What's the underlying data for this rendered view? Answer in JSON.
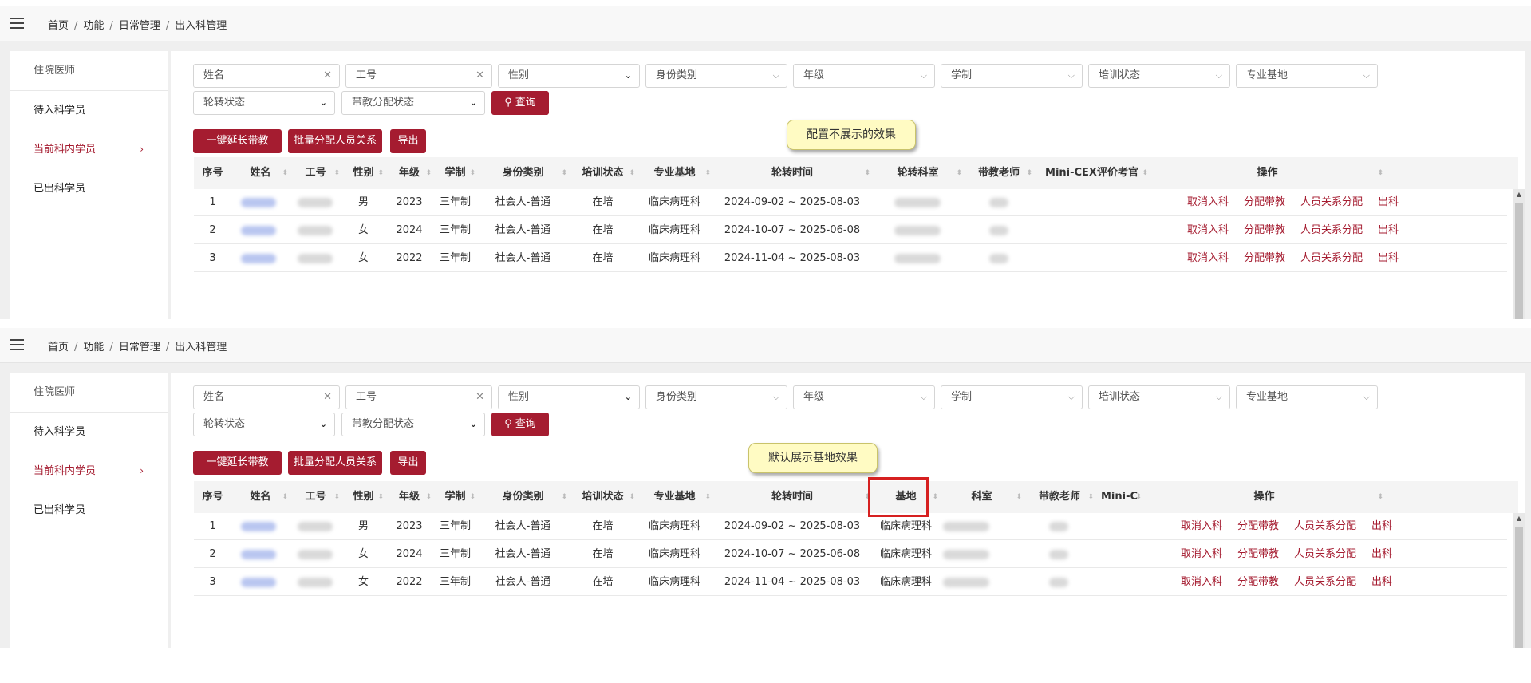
{
  "breadcrumb": [
    "首页",
    "功能",
    "日常管理",
    "出入科管理"
  ],
  "sidebar": {
    "header": "住院医师",
    "items": [
      {
        "label": "待入科学员",
        "active": false
      },
      {
        "label": "当前科内学员",
        "active": true
      },
      {
        "label": "已出科学员",
        "active": false
      }
    ]
  },
  "filters": {
    "name_placeholder": "姓名",
    "id_placeholder": "工号",
    "gender": "性别",
    "identity": "身份类别",
    "grade": "年级",
    "system": "学制",
    "training_status": "培训状态",
    "base": "专业基地",
    "rotation_status": "轮转状态",
    "mentor_status": "带教分配状态",
    "query_label": "查询"
  },
  "toolbar": {
    "extend_label": "一键延长带教",
    "batch_label": "批量分配人员关系",
    "export_label": "导出"
  },
  "callouts": {
    "top": "配置不展示的效果",
    "bottom": "默认展示基地效果"
  },
  "table1_headers": [
    "序号",
    "姓名",
    "工号",
    "性别",
    "年级",
    "学制",
    "身份类别",
    "培训状态",
    "专业基地",
    "轮转时间",
    "轮转科室",
    "带教老师",
    "Mini-CEX评价考官",
    "操作"
  ],
  "table2_headers": [
    "序号",
    "姓名",
    "工号",
    "性别",
    "年级",
    "学制",
    "身份类别",
    "培训状态",
    "专业基地",
    "轮转时间",
    "基地",
    "科室",
    "带教老师",
    "Mini-C",
    "操作"
  ],
  "rows": [
    {
      "no": "1",
      "gender": "男",
      "grade": "2023",
      "system": "三年制",
      "identity": "社会人-普通",
      "status": "在培",
      "base": "临床病理科",
      "period": "2024-09-02 ~ 2025-08-03",
      "site": "临床病理科"
    },
    {
      "no": "2",
      "gender": "女",
      "grade": "2024",
      "system": "三年制",
      "identity": "社会人-普通",
      "status": "在培",
      "base": "临床病理科",
      "period": "2024-10-07 ~ 2025-06-08",
      "site": "临床病理科"
    },
    {
      "no": "3",
      "gender": "女",
      "grade": "2022",
      "system": "三年制",
      "identity": "社会人-普通",
      "status": "在培",
      "base": "临床病理科",
      "period": "2024-11-04 ~ 2025-08-03",
      "site": "临床病理科"
    }
  ],
  "actions": [
    "取消入科",
    "分配带教",
    "人员关系分配",
    "出科"
  ],
  "colors": {
    "accent": "#a51c30",
    "callout_bg": "#fffbc3",
    "highlight": "#d62020"
  }
}
